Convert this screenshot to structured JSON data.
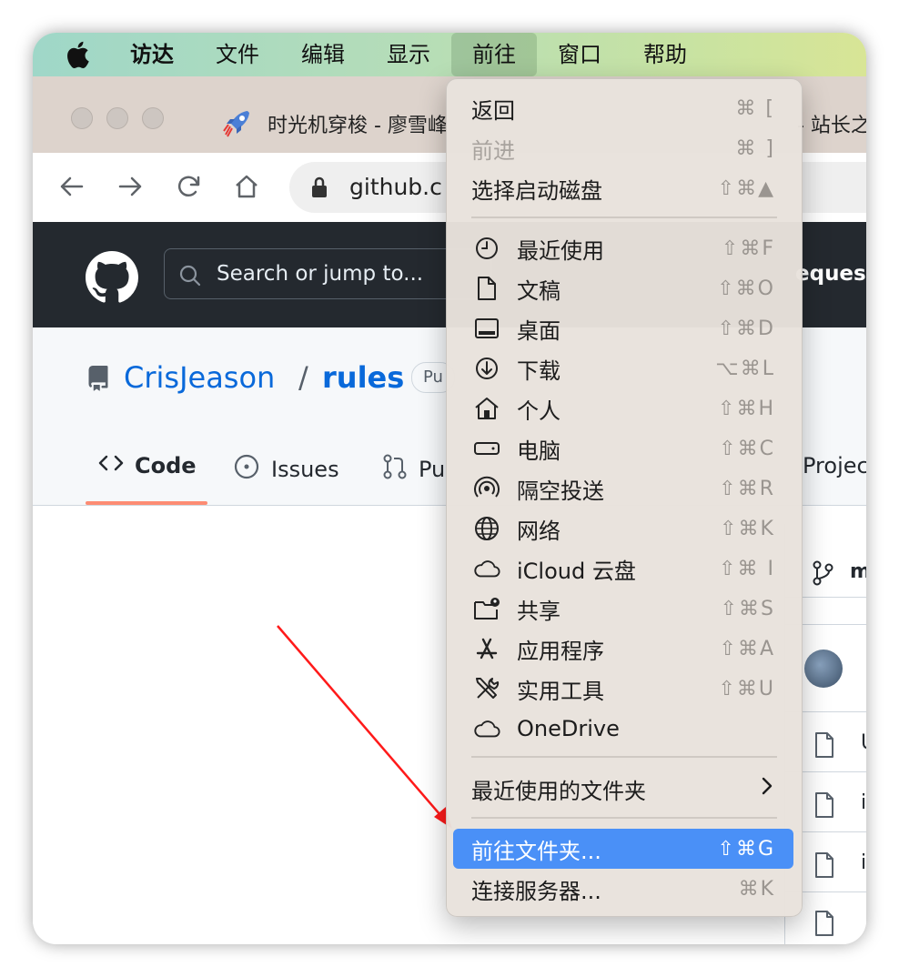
{
  "menubar": {
    "items": [
      "访达",
      "文件",
      "编辑",
      "显示",
      "前往",
      "窗口",
      "帮助"
    ],
    "active": "前往"
  },
  "browser": {
    "tab_title": "时光机穿梭 - 廖雪峰",
    "tab_title_right": "- 站长之",
    "url": "github.c"
  },
  "github": {
    "search_placeholder": "Search or jump to...",
    "header_right": "equest",
    "repo_owner": "CrisJeason",
    "repo_sep": "/",
    "repo_name": "rules",
    "repo_badge": "Pu",
    "tabs": [
      {
        "label": "Code"
      },
      {
        "label": "Issues"
      },
      {
        "label": "Pu"
      },
      {
        "label": "Projec"
      }
    ],
    "branch": "m",
    "file_rows": [
      "U",
      "i",
      "i"
    ]
  },
  "go_menu": {
    "back": {
      "label": "返回",
      "shortcut": "⌘ ["
    },
    "forward": {
      "label": "前进",
      "shortcut": "⌘ ]"
    },
    "startup_disk": {
      "label": "选择启动磁盘",
      "shortcut": "⇧⌘▲"
    },
    "places": [
      {
        "label": "最近使用",
        "shortcut": "⇧⌘F",
        "icon": "clock-icon"
      },
      {
        "label": "文稿",
        "shortcut": "⇧⌘O",
        "icon": "document-icon"
      },
      {
        "label": "桌面",
        "shortcut": "⇧⌘D",
        "icon": "desktop-icon"
      },
      {
        "label": "下载",
        "shortcut": "⌥⌘L",
        "icon": "download-icon"
      },
      {
        "label": "个人",
        "shortcut": "⇧⌘H",
        "icon": "home-icon"
      },
      {
        "label": "电脑",
        "shortcut": "⇧⌘C",
        "icon": "computer-icon"
      },
      {
        "label": "隔空投送",
        "shortcut": "⇧⌘R",
        "icon": "airdrop-icon"
      },
      {
        "label": "网络",
        "shortcut": "⇧⌘K",
        "icon": "network-icon"
      },
      {
        "label": "iCloud 云盘",
        "shortcut": "⇧⌘ I",
        "icon": "icloud-icon"
      },
      {
        "label": "共享",
        "shortcut": "⇧⌘S",
        "icon": "shared-folder-icon"
      },
      {
        "label": "应用程序",
        "shortcut": "⇧⌘A",
        "icon": "applications-icon"
      },
      {
        "label": "实用工具",
        "shortcut": "⇧⌘U",
        "icon": "utilities-icon"
      },
      {
        "label": "OneDrive",
        "shortcut": "",
        "icon": "onedrive-icon"
      }
    ],
    "recent_folders": {
      "label": "最近使用的文件夹"
    },
    "go_to_folder": {
      "label": "前往文件夹...",
      "shortcut": "⇧⌘G"
    },
    "connect_server": {
      "label": "连接服务器...",
      "shortcut": "⌘K"
    }
  },
  "colors": {
    "highlight": "#4a90f7",
    "arrow": "#ff1a1a",
    "github_header": "#24292f",
    "link": "#0969da"
  }
}
